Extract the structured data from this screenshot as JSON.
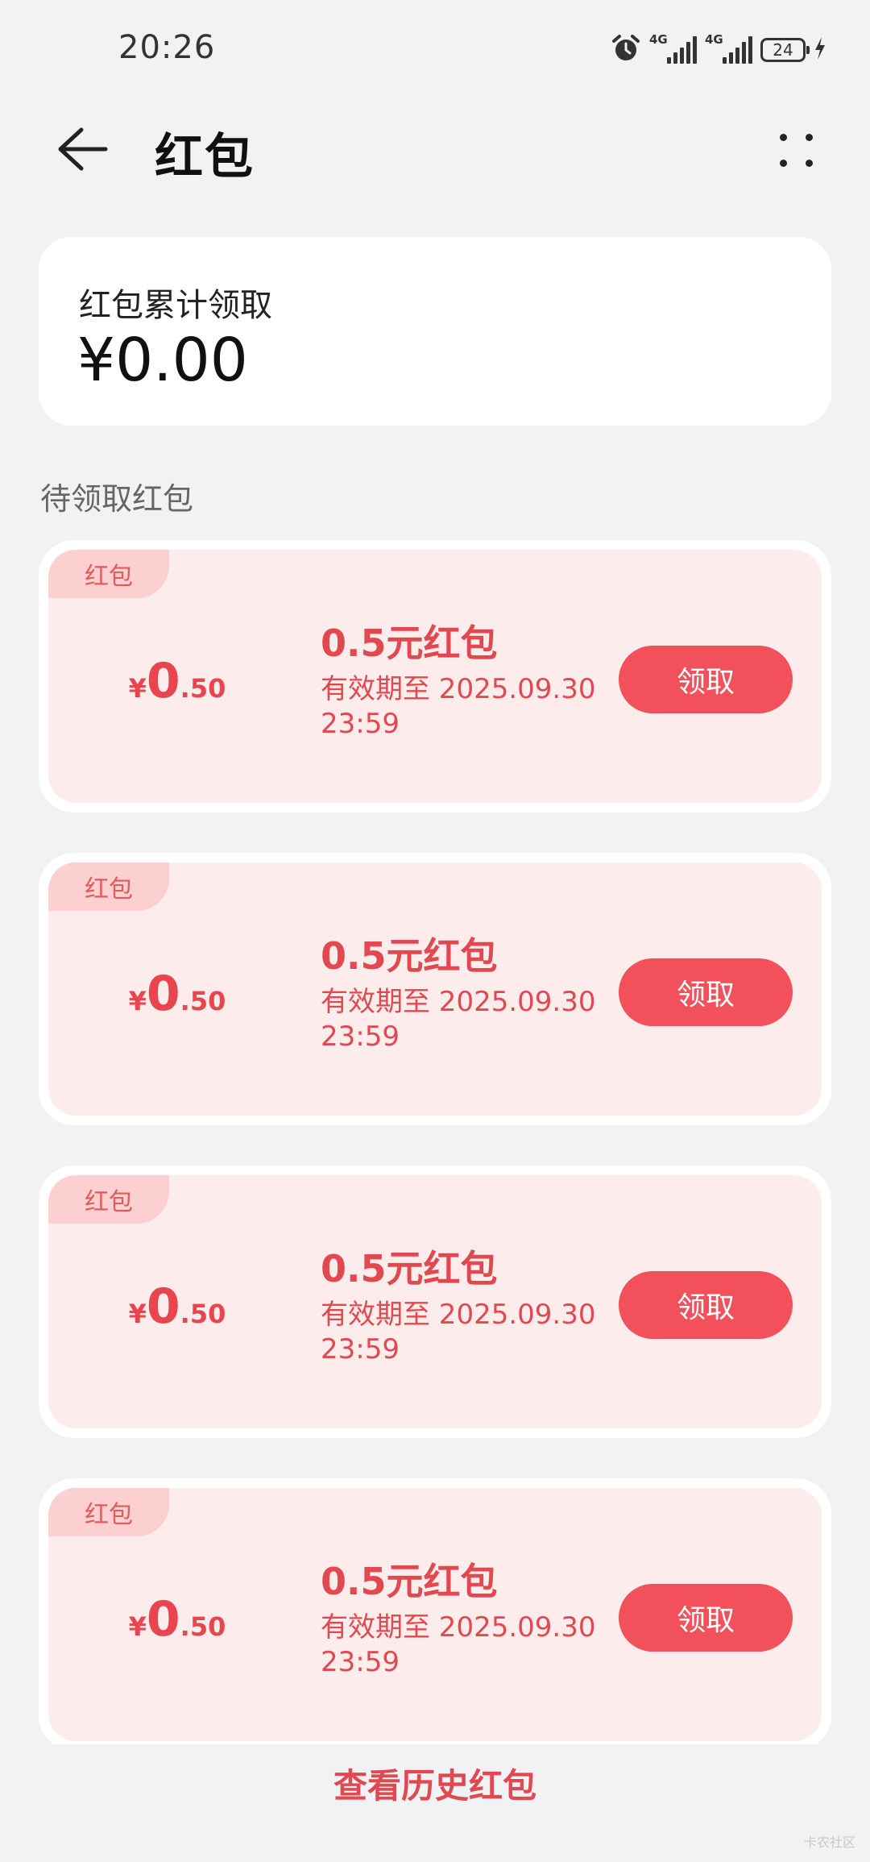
{
  "status_bar": {
    "time": "20:26",
    "network_1": "4G",
    "network_2": "4G",
    "battery": "24"
  },
  "header": {
    "title": "红包"
  },
  "summary": {
    "label": "红包累计领取",
    "amount": "¥0.00"
  },
  "section": {
    "title": "待领取红包"
  },
  "packets": [
    {
      "tag": "红包",
      "currency": "¥",
      "amount_int": "0",
      "amount_dec": ".50",
      "title": "0.5元红包",
      "validity": "有效期至 2025.09.30 23:59",
      "button": "领取"
    },
    {
      "tag": "红包",
      "currency": "¥",
      "amount_int": "0",
      "amount_dec": ".50",
      "title": "0.5元红包",
      "validity": "有效期至 2025.09.30 23:59",
      "button": "领取"
    },
    {
      "tag": "红包",
      "currency": "¥",
      "amount_int": "0",
      "amount_dec": ".50",
      "title": "0.5元红包",
      "validity": "有效期至 2025.09.30 23:59",
      "button": "领取"
    },
    {
      "tag": "红包",
      "currency": "¥",
      "amount_int": "0",
      "amount_dec": ".50",
      "title": "0.5元红包",
      "validity": "有效期至 2025.09.30 23:59",
      "button": "领取"
    }
  ],
  "footer": {
    "history_link": "查看历史红包",
    "watermark": "卡农社区"
  },
  "colors": {
    "accent": "#f2505a",
    "accent_text": "#e2484f",
    "card_bg": "#fcecec",
    "tag_bg": "#fcd0d0",
    "page_bg": "#f1f2f4"
  }
}
